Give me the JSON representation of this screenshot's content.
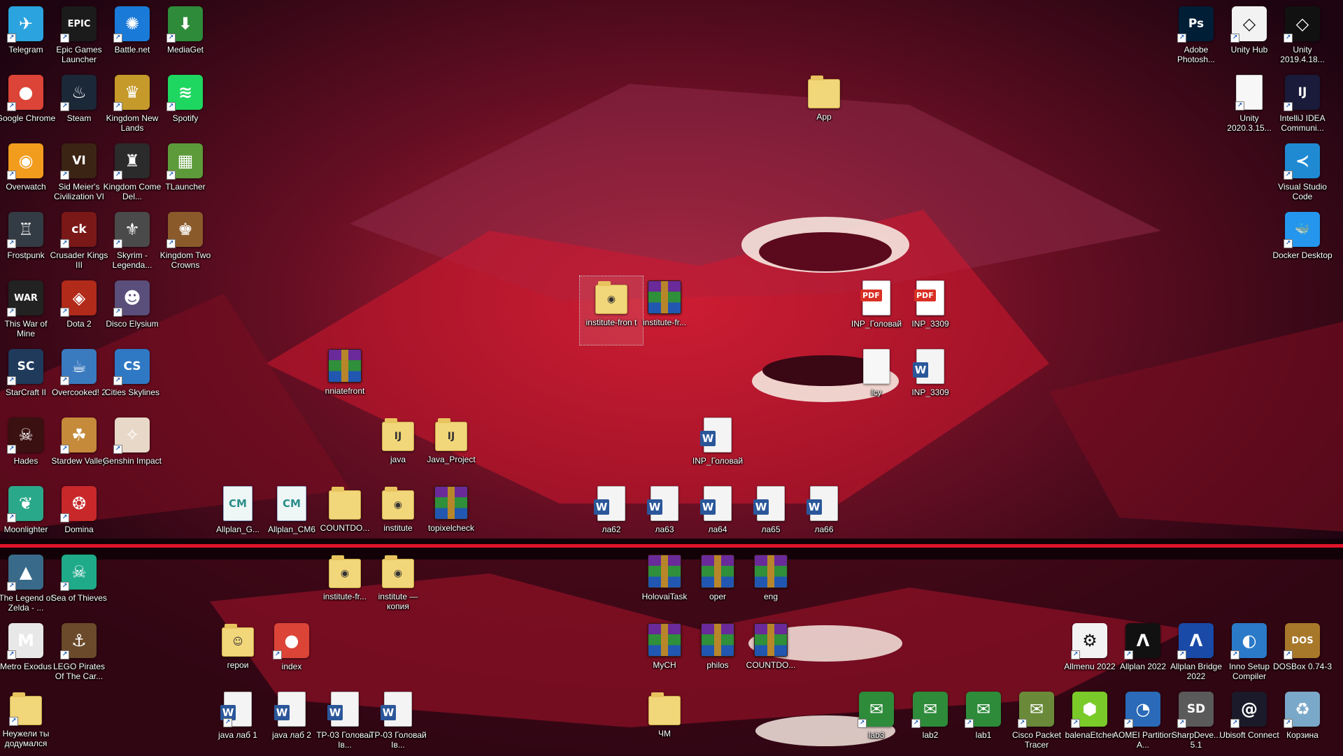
{
  "desktop": {
    "icons": [
      {
        "label": "Telegram",
        "icon": "telegram-icon",
        "color": "#2aa3df",
        "glyph": "✈"
      },
      {
        "label": "Epic Games Launcher",
        "icon": "epic-games-icon",
        "color": "#1b1b1b",
        "glyph": "EPIC"
      },
      {
        "label": "Battle.net",
        "icon": "battlenet-icon",
        "color": "#1a7ad8",
        "glyph": "✺"
      },
      {
        "label": "MediaGet",
        "icon": "mediaget-icon",
        "color": "#2e8b3a",
        "glyph": "⬇"
      },
      {
        "label": "Google Chrome",
        "icon": "chrome-icon",
        "color": "#db4437",
        "glyph": "●"
      },
      {
        "label": "Steam",
        "icon": "steam-icon",
        "color": "#1b2838",
        "glyph": "♨"
      },
      {
        "label": "Kingdom New Lands",
        "icon": "kingdom-crown-icon",
        "color": "#c59a2a",
        "glyph": "♛"
      },
      {
        "label": "Spotify",
        "icon": "spotify-icon",
        "color": "#1ed760",
        "glyph": "≋"
      },
      {
        "label": "Overwatch",
        "icon": "overwatch-icon",
        "color": "#f29c1e",
        "glyph": "◉"
      },
      {
        "label": "Sid Meier's Civilization VI",
        "icon": "civilization-icon",
        "color": "#3b2414",
        "glyph": "VI"
      },
      {
        "label": "Kingdom Come Del...",
        "icon": "kingdom-come-icon",
        "color": "#2b2b2b",
        "glyph": "♜"
      },
      {
        "label": "TLauncher",
        "icon": "minecraft-block-icon",
        "color": "#5d9b3a",
        "glyph": "▦"
      },
      {
        "label": "Frostpunk",
        "icon": "frostpunk-icon",
        "color": "#333b44",
        "glyph": "♖"
      },
      {
        "label": "Crusader Kings III",
        "icon": "crusader-kings-icon",
        "color": "#7a1818",
        "glyph": "ck"
      },
      {
        "label": "Skyrim - Legenda...",
        "icon": "skyrim-icon",
        "color": "#4a4a4a",
        "glyph": "⚜"
      },
      {
        "label": "Kingdom Two Crowns",
        "icon": "kingdom-two-crowns-icon",
        "color": "#8b5a2b",
        "glyph": "♚"
      },
      {
        "label": "This War of Mine",
        "icon": "this-war-of-mine-icon",
        "color": "#222222",
        "glyph": "WAR"
      },
      {
        "label": "Dota 2",
        "icon": "dota2-icon",
        "color": "#b22a1a",
        "glyph": "◈"
      },
      {
        "label": "Disco Elysium",
        "icon": "disco-elysium-icon",
        "color": "#5a4e7a",
        "glyph": "☻"
      },
      {
        "label": "StarCraft II",
        "icon": "starcraft-icon",
        "color": "#1f3a5a",
        "glyph": "SC"
      },
      {
        "label": "Overcooked! 2",
        "icon": "overcooked-icon",
        "color": "#3a7abf",
        "glyph": "☕"
      },
      {
        "label": "Cities Skylines",
        "icon": "cities-skylines-icon",
        "color": "#2f78c4",
        "glyph": "CS"
      },
      {
        "label": "Hades",
        "icon": "hades-icon",
        "color": "#3a1010",
        "glyph": "☠"
      },
      {
        "label": "Stardew Valley",
        "icon": "stardew-valley-icon",
        "color": "#c58a3a",
        "glyph": "☘"
      },
      {
        "label": "Genshin Impact",
        "icon": "genshin-impact-icon",
        "color": "#e8d8c8",
        "glyph": "✧"
      },
      {
        "label": "Moonlighter",
        "icon": "moonlighter-icon",
        "color": "#2aa88a",
        "glyph": "❦"
      },
      {
        "label": "Domina",
        "icon": "domina-icon",
        "color": "#c8282a",
        "glyph": "❂"
      },
      {
        "label": "The Legend of Zelda - ...",
        "icon": "zelda-icon",
        "color": "#3a6a8a",
        "glyph": "▲"
      },
      {
        "label": "Sea of Thieves",
        "icon": "sea-of-thieves-icon",
        "color": "#1faa8a",
        "glyph": "☠"
      },
      {
        "label": "Metro Exodus",
        "icon": "metro-exodus-icon",
        "color": "#e8e8e8",
        "glyph": "M"
      },
      {
        "label": "LEGO Pirates Of The Car...",
        "icon": "lego-pirates-icon",
        "color": "#6a4a2a",
        "glyph": "⚓"
      },
      {
        "label": "Неужели ты додумался",
        "icon": "folder-icon",
        "type": "folder"
      },
      {
        "label": "Allplan_G...",
        "icon": "cm-file-icon",
        "type": "cm"
      },
      {
        "label": "Allplan_CM6",
        "icon": "cm-file-icon",
        "type": "cm"
      },
      {
        "label": "COUNTDO...",
        "icon": "folder-icon",
        "type": "folder"
      },
      {
        "label": "institute",
        "icon": "chrome-folder-icon",
        "type": "folder",
        "inner": "◉"
      },
      {
        "label": "topixelcheck",
        "icon": "winrar-archive-icon",
        "type": "rar"
      },
      {
        "label": "nniatefront",
        "icon": "winrar-archive-icon",
        "type": "rar"
      },
      {
        "label": "java",
        "icon": "intellij-folder-icon",
        "type": "folder",
        "inner": "IJ"
      },
      {
        "label": "Java_Project",
        "icon": "intellij-folder-icon",
        "type": "folder",
        "inner": "IJ"
      },
      {
        "label": "institute-fron t",
        "icon": "chrome-folder-icon",
        "type": "folder",
        "inner": "◉",
        "selected": true
      },
      {
        "label": "institute-fr...",
        "icon": "winrar-archive-icon",
        "type": "rar"
      },
      {
        "label": "App",
        "icon": "folder-icon",
        "type": "folder"
      },
      {
        "label": "INP_Головай",
        "icon": "pdf-file-icon",
        "type": "pdf"
      },
      {
        "label": "INP_3309",
        "icon": "pdf-file-icon",
        "type": "pdf"
      },
      {
        "label": "lcy",
        "icon": "file-icon",
        "type": "blank"
      },
      {
        "label": "INP_3309",
        "icon": "word-document-icon",
        "type": "doc"
      },
      {
        "label": "INP_Головай",
        "icon": "word-document-icon",
        "type": "doc"
      },
      {
        "label": "ла62",
        "icon": "word-document-icon",
        "type": "doc"
      },
      {
        "label": "ла63",
        "icon": "word-document-icon",
        "type": "doc"
      },
      {
        "label": "ла64",
        "icon": "word-document-icon",
        "type": "doc"
      },
      {
        "label": "ла65",
        "icon": "word-document-icon",
        "type": "doc"
      },
      {
        "label": "ла66",
        "icon": "word-document-icon",
        "type": "doc"
      },
      {
        "label": "institute-fr...",
        "icon": "chrome-folder-icon",
        "type": "folder",
        "inner": "◉"
      },
      {
        "label": "institute — копия",
        "icon": "chrome-folder-icon",
        "type": "folder",
        "inner": "◉"
      },
      {
        "label": "HolovaiTask",
        "icon": "winrar-archive-icon",
        "type": "rar"
      },
      {
        "label": "oper",
        "icon": "winrar-archive-icon",
        "type": "rar"
      },
      {
        "label": "eng",
        "icon": "winrar-archive-icon",
        "type": "rar"
      },
      {
        "label": "MyCH",
        "icon": "winrar-archive-icon",
        "type": "rar"
      },
      {
        "label": "philos",
        "icon": "winrar-archive-icon",
        "type": "rar"
      },
      {
        "label": "COUNTDO...",
        "icon": "winrar-archive-icon",
        "type": "rar"
      },
      {
        "label": "герои",
        "icon": "folder-icon",
        "type": "folder",
        "inner": "☺"
      },
      {
        "label": "index",
        "icon": "chrome-icon",
        "color": "#db4437",
        "glyph": "●"
      },
      {
        "label": "java лаб 1",
        "icon": "word-document-icon",
        "type": "doc"
      },
      {
        "label": "java лаб 2",
        "icon": "word-document-icon",
        "type": "doc"
      },
      {
        "label": "ТР-03 Головай Ів...",
        "icon": "word-document-icon",
        "type": "doc"
      },
      {
        "label": "ТР-03 Головай Ів...",
        "icon": "word-document-icon",
        "type": "doc"
      },
      {
        "label": "ЧМ",
        "icon": "folder-icon",
        "type": "folder"
      },
      {
        "label": "lab3",
        "icon": "packet-tracer-file-icon",
        "color": "#2e8b3a",
        "glyph": "✉"
      },
      {
        "label": "lab2",
        "icon": "packet-tracer-file-icon",
        "color": "#2e8b3a",
        "glyph": "✉"
      },
      {
        "label": "lab1",
        "icon": "packet-tracer-file-icon",
        "color": "#2e8b3a",
        "glyph": "✉"
      },
      {
        "label": "Cisco Packet Tracer",
        "icon": "cisco-packet-tracer-icon",
        "color": "#6a8a3a",
        "glyph": "✉"
      },
      {
        "label": "balenaEtcher",
        "icon": "balena-etcher-icon",
        "color": "#7acb2a",
        "glyph": "⬢"
      },
      {
        "label": "AOMEI Partition A...",
        "icon": "aomei-partition-icon",
        "color": "#2a6ab8",
        "glyph": "◔"
      },
      {
        "label": "SharpDeve... 5.1",
        "icon": "sharpdevelop-icon",
        "color": "#5a5a5a",
        "glyph": "SD"
      },
      {
        "label": "Ubisoft Connect",
        "icon": "ubisoft-connect-icon",
        "color": "#1a1a2a",
        "glyph": "@"
      },
      {
        "label": "Корзина",
        "icon": "recycle-bin-icon",
        "color": "#7aa8c8",
        "glyph": "♻"
      },
      {
        "label": "Allmenu 2022",
        "icon": "allmenu-gear-icon",
        "color": "#f2f2f2",
        "glyph": "⚙",
        "dark": true
      },
      {
        "label": "Allplan 2022",
        "icon": "allplan-icon",
        "color": "#111111",
        "glyph": "Λ"
      },
      {
        "label": "Allplan Bridge 2022",
        "icon": "allplan-bridge-icon",
        "color": "#1a4aa8",
        "glyph": "Λ"
      },
      {
        "label": "Inno Setup Compiler",
        "icon": "inno-setup-icon",
        "color": "#2a7ac8",
        "glyph": "◐"
      },
      {
        "label": "DOSBox 0.74-3",
        "icon": "dosbox-icon",
        "color": "#a8782a",
        "glyph": "DOS"
      },
      {
        "label": "Adobe Photosh...",
        "icon": "photoshop-icon",
        "color": "#001e36",
        "glyph": "Ps"
      },
      {
        "label": "Unity Hub",
        "icon": "unity-hub-icon",
        "color": "#f2f2f2",
        "glyph": "◇",
        "dark": true
      },
      {
        "label": "Unity 2019.4.18...",
        "icon": "unity-icon",
        "color": "#111111",
        "glyph": "◇"
      },
      {
        "label": "Unity 2020.3.15...",
        "icon": "file-icon",
        "type": "blank"
      },
      {
        "label": "IntelliJ IDEA Communi...",
        "icon": "intellij-idea-icon",
        "color": "#1a1a3a",
        "glyph": "IJ"
      },
      {
        "label": "Visual Studio Code",
        "icon": "vscode-icon",
        "color": "#1f8ad2",
        "glyph": "≺"
      },
      {
        "label": "Docker Desktop",
        "icon": "docker-icon",
        "color": "#2496ed",
        "glyph": "🐳"
      }
    ]
  }
}
